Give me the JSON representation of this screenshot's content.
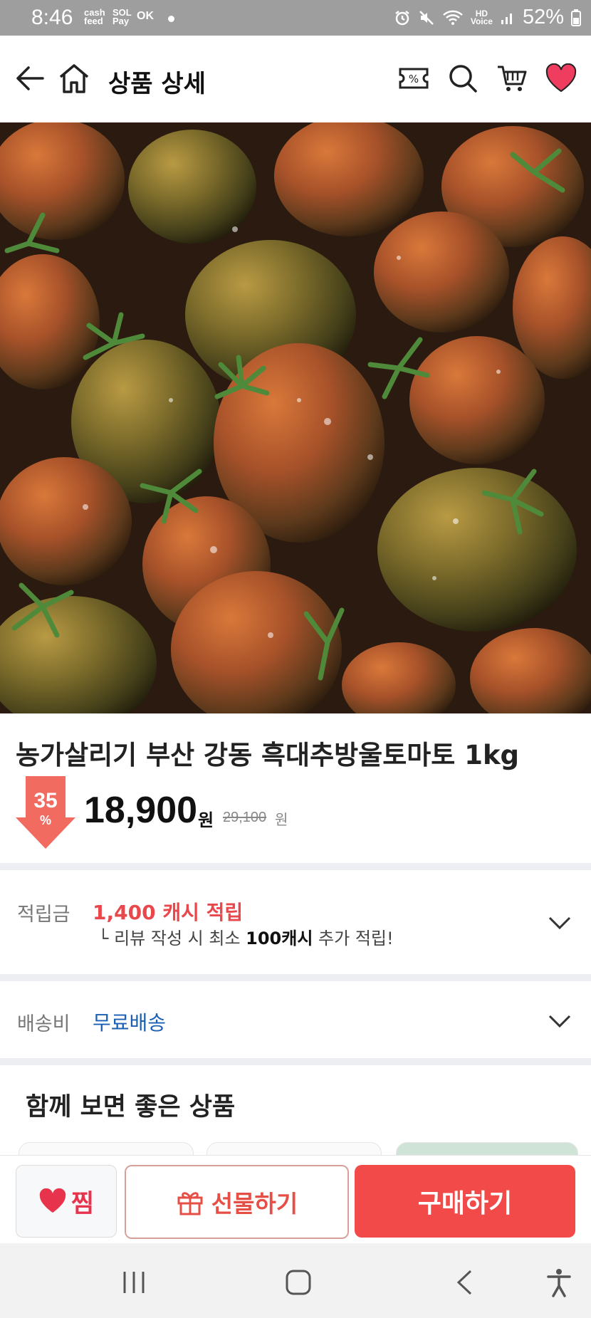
{
  "status_bar": {
    "time": "8:46",
    "apps": [
      "cash feed",
      "SOL Pay",
      "OK"
    ],
    "voice": "HD Voice",
    "battery": "52%"
  },
  "header": {
    "title": "상품 상세",
    "icons": [
      "back-arrow-icon",
      "home-icon",
      "coupon-icon",
      "search-icon",
      "cart-icon",
      "heart-icon"
    ]
  },
  "product": {
    "name": "농가살리기 부산 강동 흑대추방울토마토 1kg",
    "discount": "35",
    "discount_unit": "%",
    "price": "18,900",
    "price_unit": "원",
    "original_price": "29,100",
    "original_unit": "원"
  },
  "reward": {
    "label": "적립금",
    "value": "1,400 캐시 적립",
    "note_prefix": "└ 리뷰 작성 시 최소 ",
    "note_bold": "100캐시",
    "note_suffix": " 추가 적립!"
  },
  "shipping": {
    "label": "배송비",
    "value": "무료배송"
  },
  "related": {
    "title": "함께 보면 좋은 상품"
  },
  "actions": {
    "jjim": "찜",
    "gift": "선물하기",
    "buy": "구매하기"
  },
  "colors": {
    "accent_red": "#f24a48",
    "reward_red": "#e8474c",
    "shipping_blue": "#1a5fb4",
    "heart_pink": "#ee3d5f"
  }
}
